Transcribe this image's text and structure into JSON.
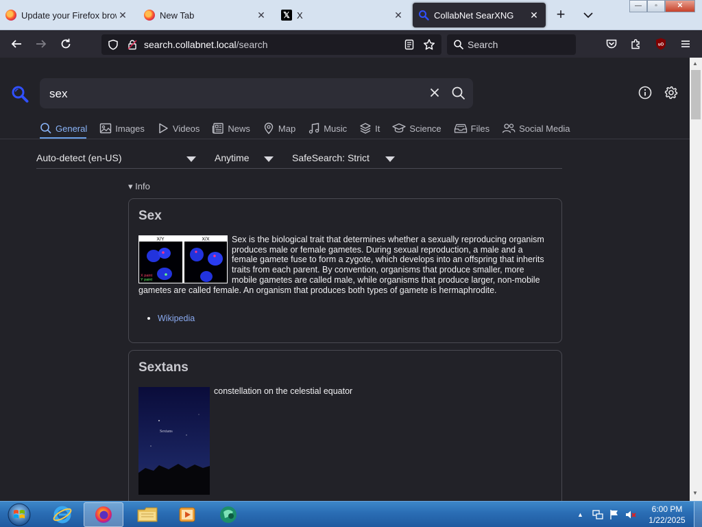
{
  "browser": {
    "tabs": [
      {
        "title": "Update your Firefox browser",
        "favicon": "firefox-icon"
      },
      {
        "title": "New Tab",
        "favicon": "firefox-icon"
      },
      {
        "title": "X",
        "favicon": "x-icon"
      },
      {
        "title": "CollabNet SearXNG",
        "favicon": "searxng-icon",
        "active": true
      }
    ],
    "url_host": "search.collabnet.local",
    "url_path": "/search",
    "search_placeholder": "Search",
    "window_controls": {
      "minimize": "—",
      "maximize": "▫",
      "close": "✕"
    }
  },
  "search": {
    "query": "sex",
    "categories": [
      "General",
      "Images",
      "Videos",
      "News",
      "Map",
      "Music",
      "It",
      "Science",
      "Files",
      "Social Media"
    ],
    "active_category": "General",
    "filters": {
      "language": "Auto-detect (en-US)",
      "time": "Anytime",
      "safesearch": "SafeSearch: Strict"
    }
  },
  "results": {
    "info_label": "▾ Info",
    "infoboxes": [
      {
        "title": "Sex",
        "image_labels": [
          "X/Y",
          "X/X"
        ],
        "image_caption_lines": [
          "X paint",
          "Y paint"
        ],
        "text": "Sex is the biological trait that determines whether a sexually reproducing organism produces male or female gametes. During sexual reproduction, a male and a female gamete fuse to form a zygote, which develops into an offspring that inherits traits from each parent. By convention, organisms that produce smaller, more mobile gametes are called male, while organisms that produce larger, non-mobile gametes are called female. An organism that produces both types of gamete is hermaphrodite.",
        "links": [
          "Wikipedia"
        ]
      },
      {
        "title": "Sextans",
        "image_label": "Sextans",
        "text": "constellation on the celestial equator"
      }
    ]
  },
  "taskbar": {
    "time": "6:00 PM",
    "date": "1/22/2025",
    "tray_arrow": "▲"
  },
  "colors": {
    "accent": "#8ab4f8",
    "page_bg": "#222228",
    "toolbar_bg": "#2b2a33"
  }
}
